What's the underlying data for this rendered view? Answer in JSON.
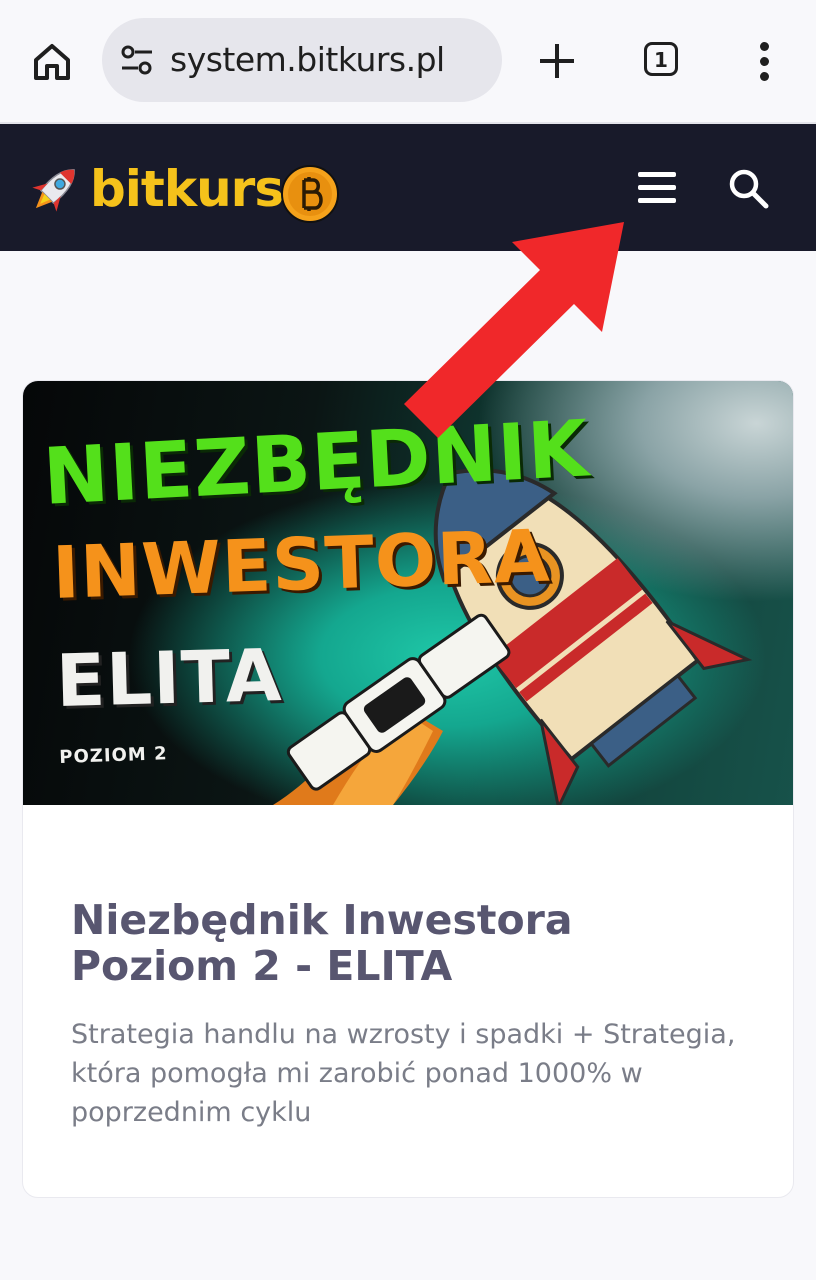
{
  "browser": {
    "url": "system.bitkurs.pl",
    "tab_count": "1"
  },
  "site": {
    "logo_text": "bitkurs",
    "colors": {
      "header_bg": "#181a2a",
      "logo_yellow": "#f5c21b",
      "arrow_red": "#f0282a"
    }
  },
  "icons": {
    "browser": [
      "home-icon",
      "tune-icon",
      "plus-icon",
      "tabs-icon",
      "more-vert-icon"
    ],
    "header": [
      "rocket-icon",
      "bitcoin-icon",
      "hamburger-menu-icon",
      "search-icon"
    ]
  },
  "card": {
    "banner": {
      "line1": "NIEZBĘDNIK",
      "line2": "INWESTORA",
      "line3": "ELITA",
      "line4": "POZIOM 2"
    },
    "title": "Niezbędnik Inwestora Poziom 2 - ELITA",
    "description": "Strategia handlu na wzrosty i spadki + Strategia, która pomogła mi zarobić ponad 1000% w poprzednim cyklu"
  }
}
